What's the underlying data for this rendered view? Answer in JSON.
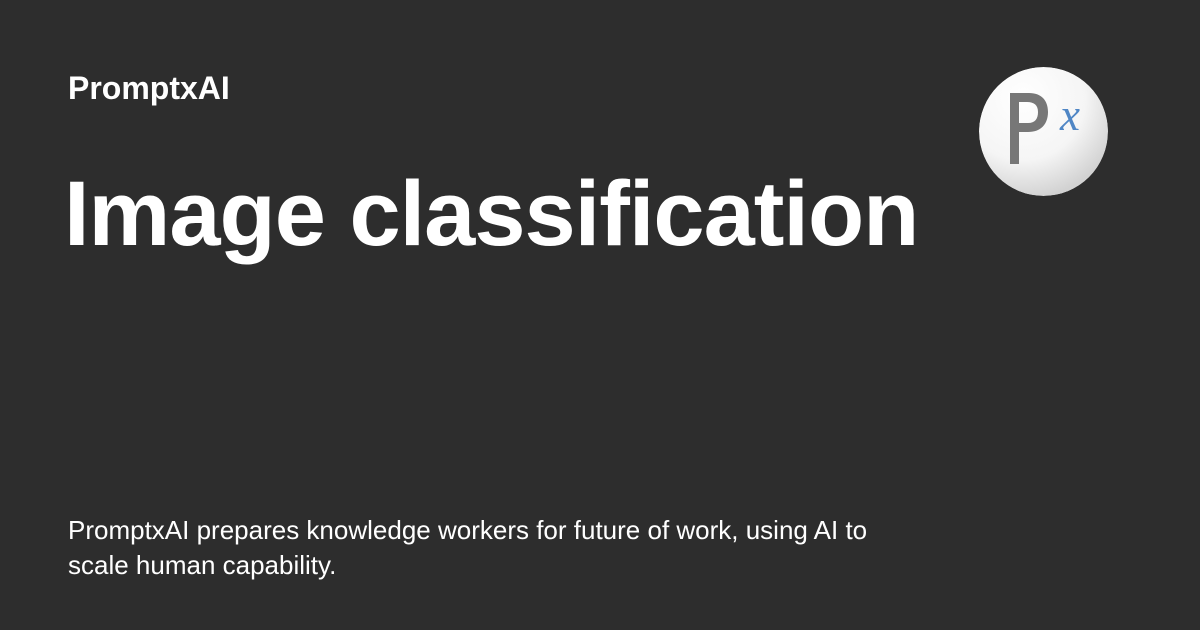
{
  "brand": {
    "name": "PromptxAI",
    "logo_icon": "promptxai-px-logo-icon",
    "logo_text": "Px",
    "logo_colors": {
      "circle_light": "#ffffff",
      "circle_dark": "#d2d2d2",
      "letter_p": "#777777",
      "letter_x": "#4f86c5"
    }
  },
  "page": {
    "title": "Image classification",
    "description": "PromptxAI prepares knowledge workers for future of work, using AI to scale human capability."
  },
  "colors": {
    "background": "#2d2d2d",
    "text": "#ffffff"
  }
}
